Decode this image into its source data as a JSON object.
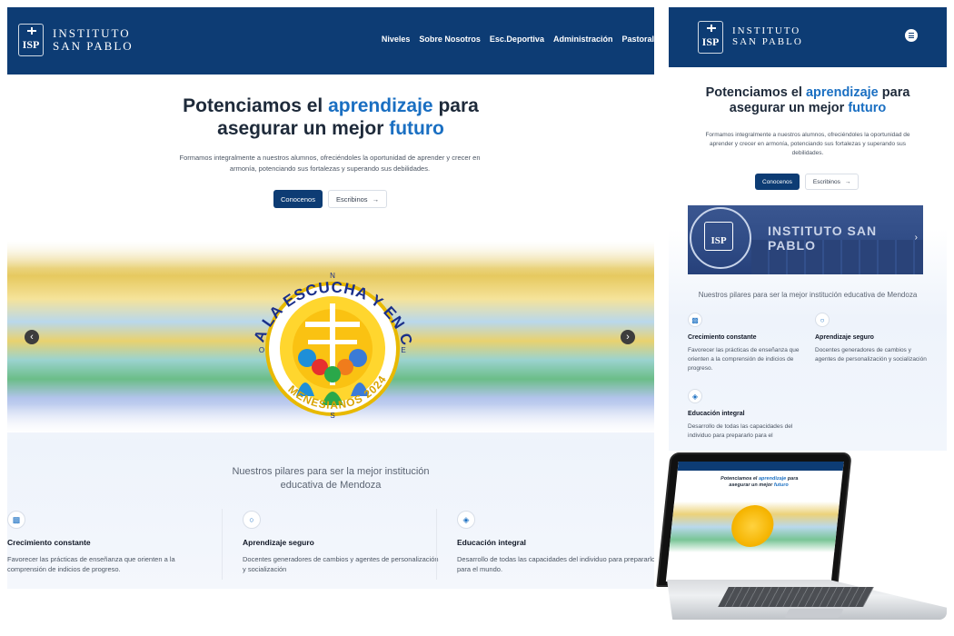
{
  "brand": {
    "logo_mark": "ISP",
    "line1": "INSTITUTO",
    "line2": "SAN PABLO",
    "primary_color": "#0d3c74",
    "accent_color": "#1a6fc2"
  },
  "nav": {
    "items": [
      "Niveles",
      "Sobre Nosotros",
      "Esc.Deportiva",
      "Administración",
      "Pastoral"
    ]
  },
  "hero": {
    "title_part1": "Potenciamos el ",
    "title_highlight1": "aprendizaje",
    "title_part2": " para",
    "title_line2": "asegurar un mejor ",
    "title_highlight2": "futuro",
    "subtitle": "Formamos integralmente a nuestros alumnos, ofreciéndoles la oportunidad de aprender y crecer en armonía, potenciando sus fortalezas y superando sus debilidades.",
    "cta_primary": "Conocenos",
    "cta_secondary": "Escribinos",
    "cta_secondary_icon": "arrow-right-icon"
  },
  "carousel": {
    "emblem_arc_text": "A LA ESCUCHA Y EN CAMINO",
    "emblem_bottom_text": "MENESIANOS 2024",
    "emblem_compass": [
      "N",
      "O",
      "E",
      "S"
    ],
    "prev_icon": "chevron-left-icon",
    "next_icon": "chevron-right-icon"
  },
  "pillars": {
    "title_desktop_line1": "Nuestros pilares para ser la mejor institución",
    "title_desktop_line2": "educativa de Mendoza",
    "title_mobile": "Nuestros pilares para ser la mejor institución educativa de Mendoza",
    "items": [
      {
        "icon": "bar-chart-icon",
        "title": "Crecimiento constante",
        "text": "Favorecer las prácticas de enseñanza que orienten a la comprensión de indicios de progreso."
      },
      {
        "icon": "lock-icon",
        "title": "Aprendizaje seguro",
        "text": "Docentes generadores de cambios y agentes de personalización y socialización"
      },
      {
        "icon": "layers-icon",
        "title": "Educación integral",
        "text": "Desarrollo de todas las capacidades del individuo para prepararlo para el mundo."
      }
    ],
    "mobile_p3_text_truncated": "Desarrollo de todas las capacidades del individuo para prepararlo para el"
  },
  "mobile": {
    "menu_icon": "hamburger-menu-icon",
    "photo_sign": "INSTITUTO SAN PABLO",
    "photo_seal_mark": "ISP"
  }
}
